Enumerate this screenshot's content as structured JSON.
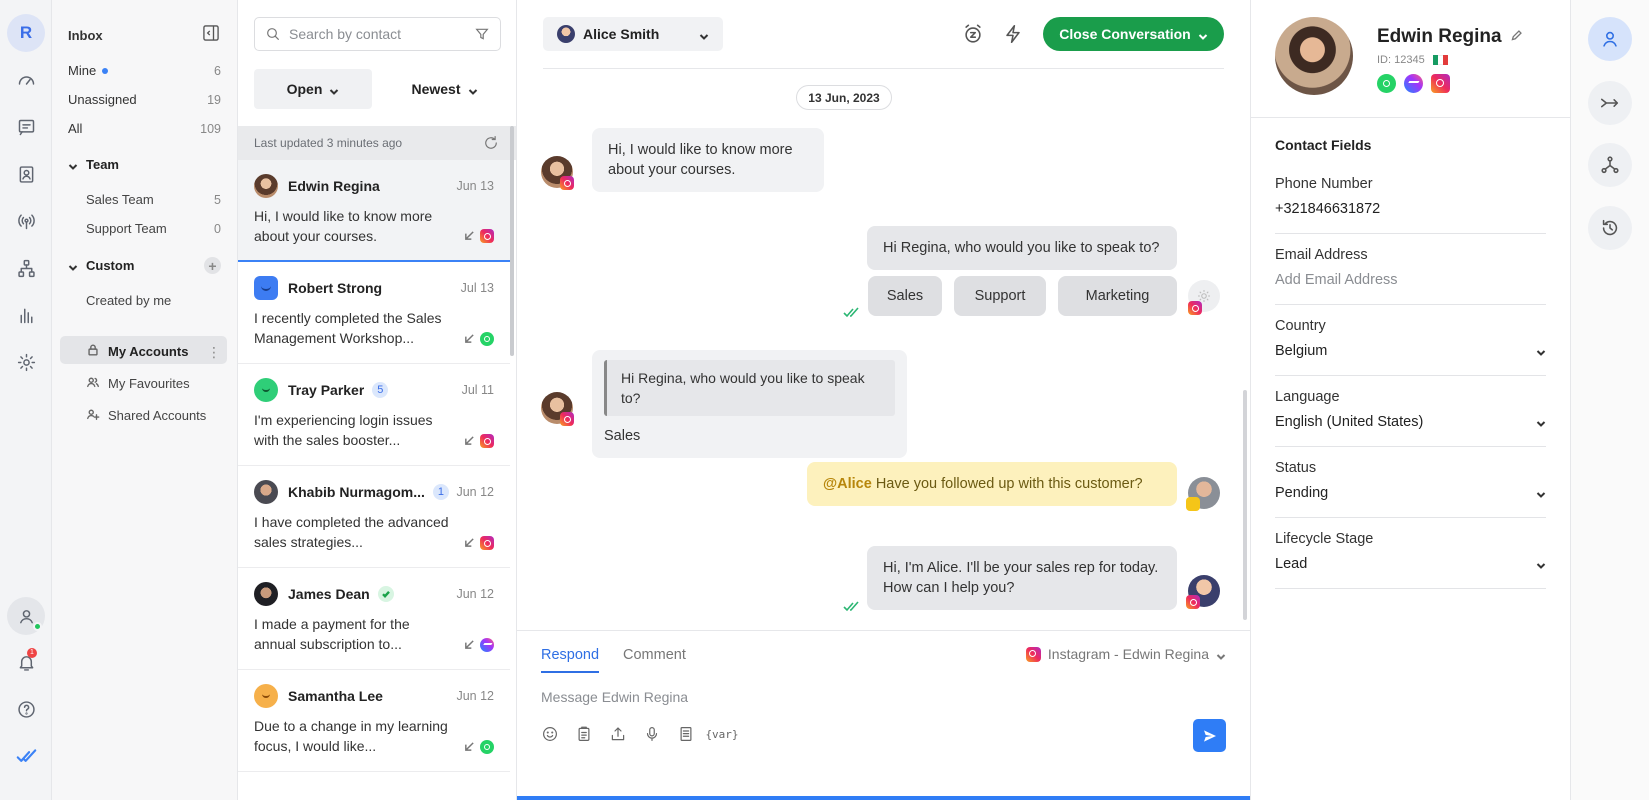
{
  "rail": {
    "workspace_initial": "R",
    "notification_count": "1",
    "items": [
      "dashboard-icon",
      "inbox-icon",
      "contacts-icon",
      "broadcast-icon",
      "workflow-icon",
      "reports-icon",
      "settings-icon"
    ]
  },
  "nav": {
    "title": "Inbox",
    "mine_label": "Mine",
    "mine_count": "6",
    "unassigned_label": "Unassigned",
    "unassigned_count": "19",
    "all_label": "All",
    "all_count": "109",
    "team_label": "Team",
    "sales_team_label": "Sales Team",
    "sales_team_count": "5",
    "support_team_label": "Support Team",
    "support_team_count": "0",
    "custom_label": "Custom",
    "created_by_me_label": "Created by me",
    "my_accounts_label": "My Accounts",
    "my_favourites_label": "My Favourites",
    "shared_accounts_label": "Shared Accounts"
  },
  "list": {
    "search_placeholder": "Search by contact",
    "status_filter": "Open",
    "sort": "Newest",
    "last_updated": "Last updated 3 minutes ago",
    "conversations": [
      {
        "name": "Edwin Regina",
        "date": "Jun 13",
        "preview": "Hi, I would like to know more about your courses.",
        "channel": "instagram"
      },
      {
        "name": "Robert Strong",
        "date": "Jul 13",
        "preview": "I recently completed the Sales Management Workshop...",
        "channel": "whatsapp"
      },
      {
        "name": "Tray Parker",
        "badge": "5",
        "date": "Jul 11",
        "preview": "I'm experiencing login issues with the sales booster...",
        "channel": "instagram"
      },
      {
        "name": "Khabib Nurmagom...",
        "badge": "1",
        "date": "Jun 12",
        "preview": "I have completed the advanced sales strategies...",
        "channel": "instagram"
      },
      {
        "name": "James Dean",
        "date": "Jun 12",
        "preview": "I made a payment for the annual subscription to...",
        "channel": "messenger"
      },
      {
        "name": "Samantha Lee",
        "date": "Jun 12",
        "preview": "Due to a change in my learning focus, I would like...",
        "channel": "whatsapp"
      }
    ]
  },
  "chat": {
    "assignee": "Alice Smith",
    "close_label": "Close Conversation",
    "date_chip": "13 Jun, 2023",
    "msg1": "Hi, I would like to know more about your courses.",
    "msg2": "Hi Regina, who would you like to speak to?",
    "options": [
      "Sales",
      "Support",
      "Marketing"
    ],
    "quote_text": "Hi Regina, who would you like to speak to?",
    "reply_text": "Sales",
    "note_mention": "@Alice",
    "note_text": "Have you followed up with this customer?",
    "msg3": "Hi, I'm Alice. I'll be your sales rep for today. How can I help you?"
  },
  "composer": {
    "tab_respond": "Respond",
    "tab_comment": "Comment",
    "channel": "Instagram - Edwin Regina",
    "placeholder": "Message Edwin Regina",
    "var_label": "{var}"
  },
  "contact": {
    "name": "Edwin Regina",
    "id": "ID: 12345",
    "section": "Contact Fields",
    "fields": [
      {
        "label": "Phone Number",
        "value": "+321846631872"
      },
      {
        "label": "Email Address",
        "value": "Add Email Address"
      },
      {
        "label": "Country",
        "value": "Belgium"
      },
      {
        "label": "Language",
        "value": "English (United States)"
      },
      {
        "label": "Status",
        "value": "Pending"
      },
      {
        "label": "Lifecycle Stage",
        "value": "Lead"
      }
    ]
  },
  "colors": {
    "accent": "#2f7df6",
    "close_button": "#1a9d4b",
    "note_bg": "#fdf1bd",
    "rail_bg": "#f3f4f6"
  }
}
